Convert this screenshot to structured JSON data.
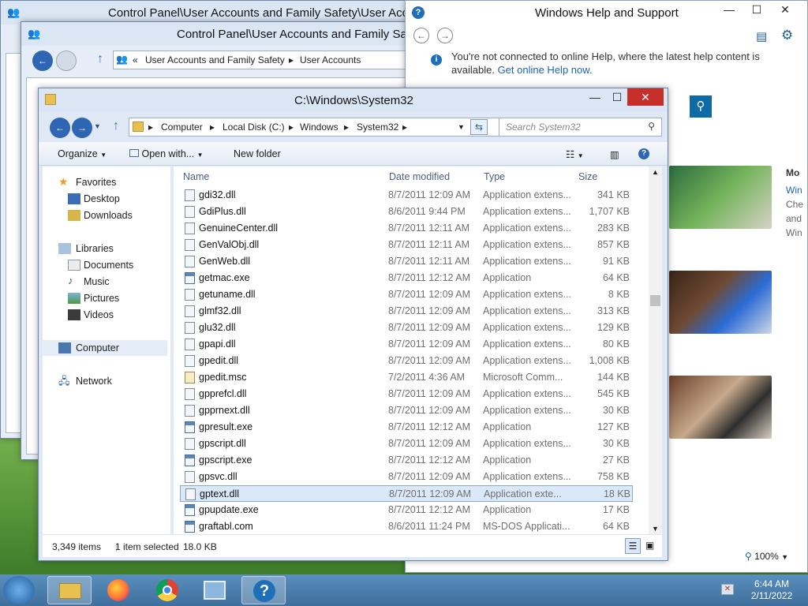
{
  "back_windows": {
    "cp1_title": "Control Panel\\User Accounts and Family Safety\\User Acco",
    "cp2_title": "Control Panel\\User Accounts and Family Safe",
    "cp2_breadcrumb_prefix": "«",
    "cp2_breadcrumb_1": "User Accounts and Family Safety",
    "cp2_breadcrumb_2": "User Accounts"
  },
  "help": {
    "title": "Windows Help and Support",
    "info_text": "You're not connected to online Help, where the latest help content is available.",
    "info_link": "Get online Help now.",
    "side_heading": "Mo",
    "side_lines": [
      "Win",
      "Che",
      "and",
      "Win"
    ],
    "zoom": "100%"
  },
  "explorer": {
    "title": "C:\\Windows\\System32",
    "address": [
      "Computer",
      "Local Disk (C:)",
      "Windows",
      "System32"
    ],
    "search_placeholder": "Search System32",
    "toolbar": {
      "organize": "Organize",
      "open_with": "Open with...",
      "new_folder": "New folder"
    },
    "nav": {
      "favorites": "Favorites",
      "desktop": "Desktop",
      "downloads": "Downloads",
      "libraries": "Libraries",
      "documents": "Documents",
      "music": "Music",
      "pictures": "Pictures",
      "videos": "Videos",
      "computer": "Computer",
      "network": "Network"
    },
    "columns": {
      "name": "Name",
      "date": "Date modified",
      "type": "Type",
      "size": "Size"
    },
    "files": [
      {
        "name": "gdi32.dll",
        "date": "8/7/2011 12:09 AM",
        "type": "Application extens...",
        "size": "341 KB",
        "kind": "dll"
      },
      {
        "name": "GdiPlus.dll",
        "date": "8/6/2011 9:44 PM",
        "type": "Application extens...",
        "size": "1,707 KB",
        "kind": "dll"
      },
      {
        "name": "GenuineCenter.dll",
        "date": "8/7/2011 12:11 AM",
        "type": "Application extens...",
        "size": "283 KB",
        "kind": "dll"
      },
      {
        "name": "GenValObj.dll",
        "date": "8/7/2011 12:11 AM",
        "type": "Application extens...",
        "size": "857 KB",
        "kind": "dll"
      },
      {
        "name": "GenWeb.dll",
        "date": "8/7/2011 12:11 AM",
        "type": "Application extens...",
        "size": "91 KB",
        "kind": "dll"
      },
      {
        "name": "getmac.exe",
        "date": "8/7/2011 12:12 AM",
        "type": "Application",
        "size": "64 KB",
        "kind": "exe"
      },
      {
        "name": "getuname.dll",
        "date": "8/7/2011 12:09 AM",
        "type": "Application extens...",
        "size": "8 KB",
        "kind": "dll"
      },
      {
        "name": "glmf32.dll",
        "date": "8/7/2011 12:09 AM",
        "type": "Application extens...",
        "size": "313 KB",
        "kind": "dll"
      },
      {
        "name": "glu32.dll",
        "date": "8/7/2011 12:09 AM",
        "type": "Application extens...",
        "size": "129 KB",
        "kind": "dll"
      },
      {
        "name": "gpapi.dll",
        "date": "8/7/2011 12:09 AM",
        "type": "Application extens...",
        "size": "80 KB",
        "kind": "dll"
      },
      {
        "name": "gpedit.dll",
        "date": "8/7/2011 12:09 AM",
        "type": "Application extens...",
        "size": "1,008 KB",
        "kind": "dll"
      },
      {
        "name": "gpedit.msc",
        "date": "7/2/2011 4:36 AM",
        "type": "Microsoft Comm...",
        "size": "144 KB",
        "kind": "msc"
      },
      {
        "name": "gpprefcl.dll",
        "date": "8/7/2011 12:09 AM",
        "type": "Application extens...",
        "size": "545 KB",
        "kind": "dll"
      },
      {
        "name": "gpprnext.dll",
        "date": "8/7/2011 12:09 AM",
        "type": "Application extens...",
        "size": "30 KB",
        "kind": "dll"
      },
      {
        "name": "gpresult.exe",
        "date": "8/7/2011 12:12 AM",
        "type": "Application",
        "size": "127 KB",
        "kind": "exe"
      },
      {
        "name": "gpscript.dll",
        "date": "8/7/2011 12:09 AM",
        "type": "Application extens...",
        "size": "30 KB",
        "kind": "dll"
      },
      {
        "name": "gpscript.exe",
        "date": "8/7/2011 12:12 AM",
        "type": "Application",
        "size": "27 KB",
        "kind": "exe"
      },
      {
        "name": "gpsvc.dll",
        "date": "8/7/2011 12:09 AM",
        "type": "Application extens...",
        "size": "758 KB",
        "kind": "dll"
      },
      {
        "name": "gptext.dll",
        "date": "8/7/2011 12:09 AM",
        "type": "Application exte...",
        "size": "18 KB",
        "kind": "dll",
        "selected": true
      },
      {
        "name": "gpupdate.exe",
        "date": "8/7/2011 12:12 AM",
        "type": "Application",
        "size": "17 KB",
        "kind": "exe"
      },
      {
        "name": "graftabl.com",
        "date": "8/6/2011 11:24 PM",
        "type": "MS-DOS Applicati...",
        "size": "64 KB",
        "kind": "exe"
      }
    ],
    "status": {
      "count": "3,349 items",
      "selected": "1 item selected",
      "size": "18.0 KB"
    }
  },
  "taskbar": {
    "time": "6:44 AM",
    "date": "2/11/2022"
  }
}
